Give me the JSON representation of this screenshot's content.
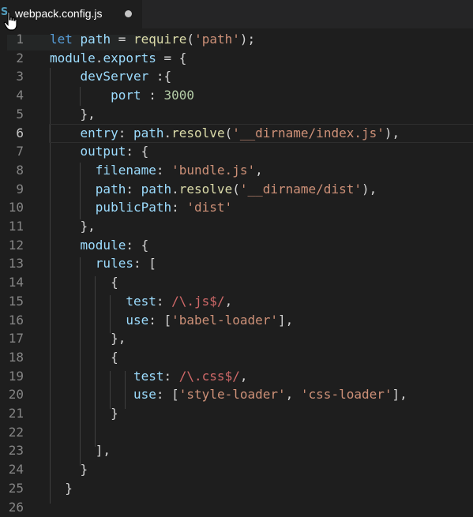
{
  "tab": {
    "icon_label": "JS",
    "title": "webpack.config.js"
  },
  "editor": {
    "language": "javascript",
    "colors": {
      "background": "#1e1e1e",
      "keyword": "#569cd6",
      "variable": "#9cdcfe",
      "function": "#dcdcaa",
      "string": "#ce9178",
      "number": "#b5cea8",
      "regex": "#d16969"
    },
    "lines": [
      {
        "num": "1",
        "tokens": [
          [
            "kw",
            "let"
          ],
          [
            "pn",
            " "
          ],
          [
            "var",
            "path"
          ],
          [
            "pn",
            " = "
          ],
          [
            "fn",
            "require"
          ],
          [
            "pn",
            "("
          ],
          [
            "str",
            "'path'"
          ],
          [
            "pn",
            ");"
          ]
        ]
      },
      {
        "num": "2",
        "tokens": [
          [
            "var",
            "module"
          ],
          [
            "pn",
            "."
          ],
          [
            "var",
            "exports"
          ],
          [
            "pn",
            " = {"
          ]
        ]
      },
      {
        "num": "3",
        "tokens": [
          [
            "pn",
            "    "
          ],
          [
            "var",
            "devServer"
          ],
          [
            "pn",
            " :{"
          ]
        ]
      },
      {
        "num": "4",
        "tokens": [
          [
            "pn",
            "        "
          ],
          [
            "var",
            "port"
          ],
          [
            "pn",
            " : "
          ],
          [
            "num",
            "3000"
          ]
        ]
      },
      {
        "num": "5",
        "tokens": [
          [
            "pn",
            "    },"
          ]
        ]
      },
      {
        "num": "6",
        "tokens": [
          [
            "pn",
            "    "
          ],
          [
            "var",
            "entry"
          ],
          [
            "pn",
            ": "
          ],
          [
            "var",
            "path"
          ],
          [
            "pn",
            "."
          ],
          [
            "fn",
            "resolve"
          ],
          [
            "pn",
            "("
          ],
          [
            "str",
            "'__dirname/index.js'"
          ],
          [
            "pn",
            "),"
          ]
        ]
      },
      {
        "num": "7",
        "tokens": [
          [
            "pn",
            "    "
          ],
          [
            "var",
            "output"
          ],
          [
            "pn",
            ": {"
          ]
        ]
      },
      {
        "num": "8",
        "tokens": [
          [
            "pn",
            "      "
          ],
          [
            "var",
            "filename"
          ],
          [
            "pn",
            ": "
          ],
          [
            "str",
            "'bundle.js'"
          ],
          [
            "pn",
            ","
          ]
        ]
      },
      {
        "num": "9",
        "tokens": [
          [
            "pn",
            "      "
          ],
          [
            "var",
            "path"
          ],
          [
            "pn",
            ": "
          ],
          [
            "var",
            "path"
          ],
          [
            "pn",
            "."
          ],
          [
            "fn",
            "resolve"
          ],
          [
            "pn",
            "("
          ],
          [
            "str",
            "'__dirname/dist'"
          ],
          [
            "pn",
            "),"
          ]
        ]
      },
      {
        "num": "10",
        "tokens": [
          [
            "pn",
            "      "
          ],
          [
            "var",
            "publicPath"
          ],
          [
            "pn",
            ": "
          ],
          [
            "str",
            "'dist'"
          ]
        ]
      },
      {
        "num": "11",
        "tokens": [
          [
            "pn",
            "    },"
          ]
        ]
      },
      {
        "num": "12",
        "tokens": [
          [
            "pn",
            "    "
          ],
          [
            "var",
            "module"
          ],
          [
            "pn",
            ": {"
          ]
        ]
      },
      {
        "num": "13",
        "tokens": [
          [
            "pn",
            "      "
          ],
          [
            "var",
            "rules"
          ],
          [
            "pn",
            ": ["
          ]
        ]
      },
      {
        "num": "14",
        "tokens": [
          [
            "pn",
            "        {"
          ]
        ]
      },
      {
        "num": "15",
        "tokens": [
          [
            "pn",
            "          "
          ],
          [
            "var",
            "test"
          ],
          [
            "pn",
            ": "
          ],
          [
            "re",
            "/\\.js$/"
          ],
          [
            "pn",
            ","
          ]
        ]
      },
      {
        "num": "16",
        "tokens": [
          [
            "pn",
            "          "
          ],
          [
            "var",
            "use"
          ],
          [
            "pn",
            ": ["
          ],
          [
            "str",
            "'babel-loader'"
          ],
          [
            "pn",
            "],"
          ]
        ]
      },
      {
        "num": "17",
        "tokens": [
          [
            "pn",
            "        },"
          ]
        ]
      },
      {
        "num": "18",
        "tokens": [
          [
            "pn",
            "        {"
          ]
        ]
      },
      {
        "num": "19",
        "tokens": [
          [
            "pn",
            "           "
          ],
          [
            "var",
            "test"
          ],
          [
            "pn",
            ": "
          ],
          [
            "re",
            "/\\.css$/"
          ],
          [
            "pn",
            ","
          ]
        ]
      },
      {
        "num": "20",
        "tokens": [
          [
            "pn",
            "           "
          ],
          [
            "var",
            "use"
          ],
          [
            "pn",
            ": ["
          ],
          [
            "str",
            "'style-loader'"
          ],
          [
            "pn",
            ", "
          ],
          [
            "str",
            "'css-loader'"
          ],
          [
            "pn",
            "],"
          ]
        ]
      },
      {
        "num": "21",
        "tokens": [
          [
            "pn",
            "        }"
          ]
        ]
      },
      {
        "num": "22",
        "tokens": []
      },
      {
        "num": "23",
        "tokens": [
          [
            "pn",
            "      ],"
          ]
        ]
      },
      {
        "num": "24",
        "tokens": [
          [
            "pn",
            "    }"
          ]
        ]
      },
      {
        "num": "25",
        "tokens": [
          [
            "pn",
            "  }"
          ]
        ]
      },
      {
        "num": "26",
        "tokens": []
      }
    ]
  }
}
